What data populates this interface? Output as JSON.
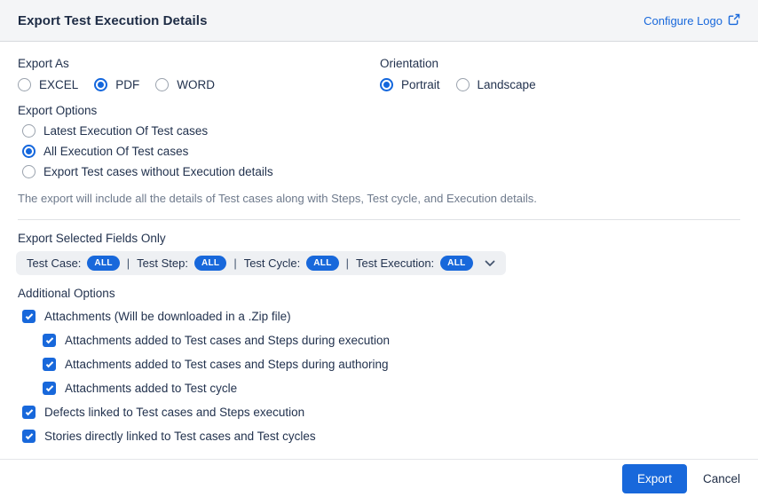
{
  "header": {
    "title": "Export Test Execution Details",
    "configure_logo_label": "Configure Logo"
  },
  "export_as": {
    "label": "Export As",
    "options": [
      {
        "label": "EXCEL",
        "selected": false
      },
      {
        "label": "PDF",
        "selected": true
      },
      {
        "label": "WORD",
        "selected": false
      }
    ]
  },
  "orientation": {
    "label": "Orientation",
    "options": [
      {
        "label": "Portrait",
        "selected": true
      },
      {
        "label": "Landscape",
        "selected": false
      }
    ]
  },
  "export_options": {
    "label": "Export Options",
    "options": [
      {
        "label": "Latest Execution Of Test cases",
        "selected": false
      },
      {
        "label": "All Execution Of Test cases",
        "selected": true
      },
      {
        "label": "Export Test cases without Execution details",
        "selected": false
      }
    ],
    "note": "The export will include all the details of Test cases along with Steps, Test cycle, and Execution details."
  },
  "selected_fields": {
    "label": "Export Selected Fields Only",
    "separator": "|",
    "fields": [
      {
        "name": "Test Case:",
        "value": "ALL"
      },
      {
        "name": "Test Step:",
        "value": "ALL"
      },
      {
        "name": "Test Cycle:",
        "value": "ALL"
      },
      {
        "name": "Test Execution:",
        "value": "ALL"
      }
    ]
  },
  "additional_options": {
    "label": "Additional Options",
    "items": [
      {
        "label": "Attachments (Will be downloaded in a .Zip file)",
        "checked": true
      },
      {
        "label": "Attachments added to Test cases and Steps during execution",
        "checked": true
      },
      {
        "label": "Attachments added to Test cases and Steps during authoring",
        "checked": true
      },
      {
        "label": "Attachments added to Test cycle",
        "checked": true
      },
      {
        "label": "Defects linked to Test cases and Steps execution",
        "checked": true
      },
      {
        "label": "Stories directly linked to Test cases and Test cycles",
        "checked": true
      }
    ]
  },
  "footer": {
    "export_label": "Export",
    "cancel_label": "Cancel"
  },
  "colors": {
    "accent_blue": "#1868db",
    "header_bg": "#f4f5f7",
    "text_navy": "#22324e",
    "muted_gray": "#6e7a8c",
    "bar_bg": "#eef0f3"
  }
}
